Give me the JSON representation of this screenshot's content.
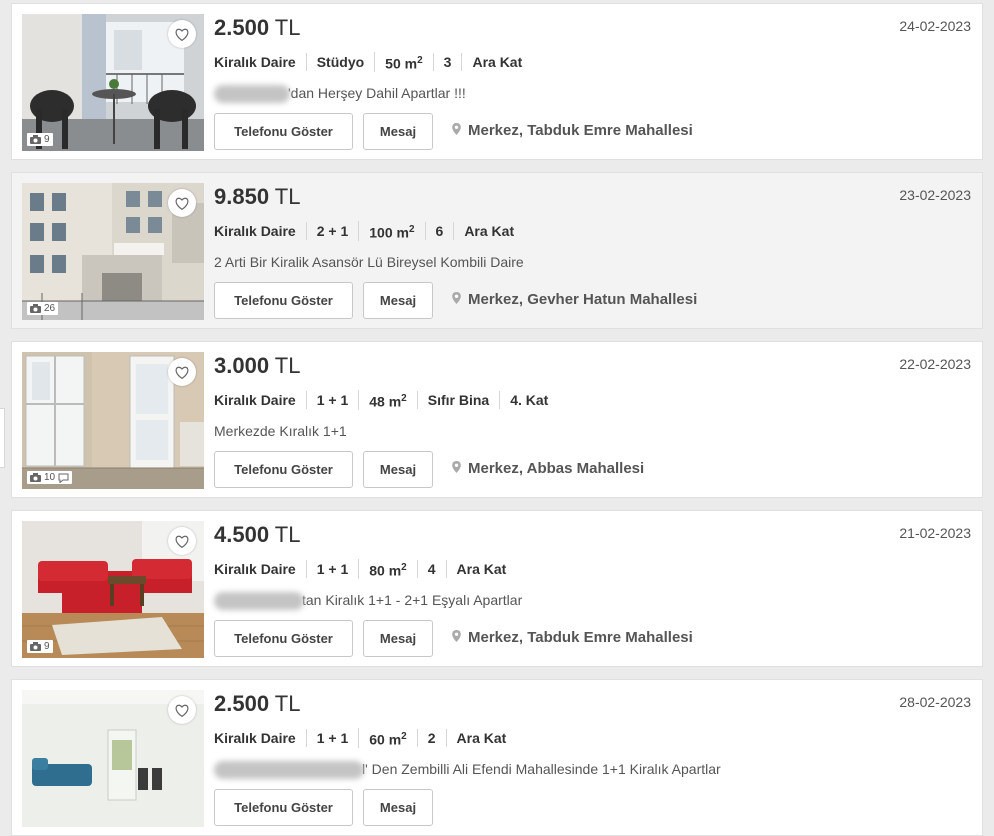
{
  "edge_tab": "",
  "listings": [
    {
      "price_amount": "2.500",
      "currency": "TL",
      "date": "24-02-2023",
      "specs": [
        "Kiralık Daire",
        "Stüdyo",
        "50 m",
        "3",
        "Ara Kat"
      ],
      "area_sup": "2",
      "area_index": 2,
      "title_blurred": true,
      "title": "'dan Herşey Dahil Apartlar !!!",
      "photo_count": "9",
      "photo_extra": "",
      "phone_label": "Telefonu Göster",
      "message_label": "Mesaj",
      "location": "Merkez, Tabduk Emre Mahallesi",
      "favorite_icon": "heart-outline-icon",
      "camera_icon": "camera-icon"
    },
    {
      "price_amount": "9.850",
      "currency": "TL",
      "date": "23-02-2023",
      "specs": [
        "Kiralık Daire",
        "2 + 1",
        "100 m",
        "6",
        "Ara Kat"
      ],
      "area_sup": "2",
      "area_index": 2,
      "title_blurred": false,
      "title": "2 Arti Bir Kiralik Asansör Lü Bireysel Kombili Daire",
      "photo_count": "26",
      "photo_extra": "",
      "phone_label": "Telefonu Göster",
      "message_label": "Mesaj",
      "location": "Merkez, Gevher Hatun Mahallesi",
      "favorite_icon": "heart-outline-icon",
      "camera_icon": "camera-icon"
    },
    {
      "price_amount": "3.000",
      "currency": "TL",
      "date": "22-02-2023",
      "specs": [
        "Kiralık Daire",
        "1 + 1",
        "48 m",
        "Sıfır Bina",
        "4. Kat"
      ],
      "area_sup": "2",
      "area_index": 2,
      "title_blurred": false,
      "title": "Merkezde Kıralık 1+1",
      "photo_count": "10",
      "photo_extra": "chat",
      "phone_label": "Telefonu Göster",
      "message_label": "Mesaj",
      "location": "Merkez, Abbas Mahallesi",
      "favorite_icon": "heart-outline-icon",
      "camera_icon": "camera-icon"
    },
    {
      "price_amount": "4.500",
      "currency": "TL",
      "date": "21-02-2023",
      "specs": [
        "Kiralık Daire",
        "1 + 1",
        "80 m",
        "4",
        "Ara Kat"
      ],
      "area_sup": "2",
      "area_index": 2,
      "title_blurred": true,
      "title": "tan Kiralık 1+1 - 2+1 Eşyalı Apartlar",
      "photo_count": "9",
      "photo_extra": "",
      "phone_label": "Telefonu Göster",
      "message_label": "Mesaj",
      "location": "Merkez, Tabduk Emre Mahallesi",
      "favorite_icon": "heart-outline-icon",
      "camera_icon": "camera-icon"
    },
    {
      "price_amount": "2.500",
      "currency": "TL",
      "date": "28-02-2023",
      "specs": [
        "Kiralık Daire",
        "1 + 1",
        "60 m",
        "2",
        "Ara Kat"
      ],
      "area_sup": "2",
      "area_index": 2,
      "title_blurred": true,
      "title": "l' Den Zembilli Ali Efendi Mahallesinde 1+1 Kiralık Apartlar",
      "photo_count": "",
      "photo_extra": "",
      "phone_label": "Telefonu Göster",
      "message_label": "Mesaj",
      "location": "",
      "favorite_icon": "heart-outline-icon",
      "camera_icon": "camera-icon"
    }
  ]
}
